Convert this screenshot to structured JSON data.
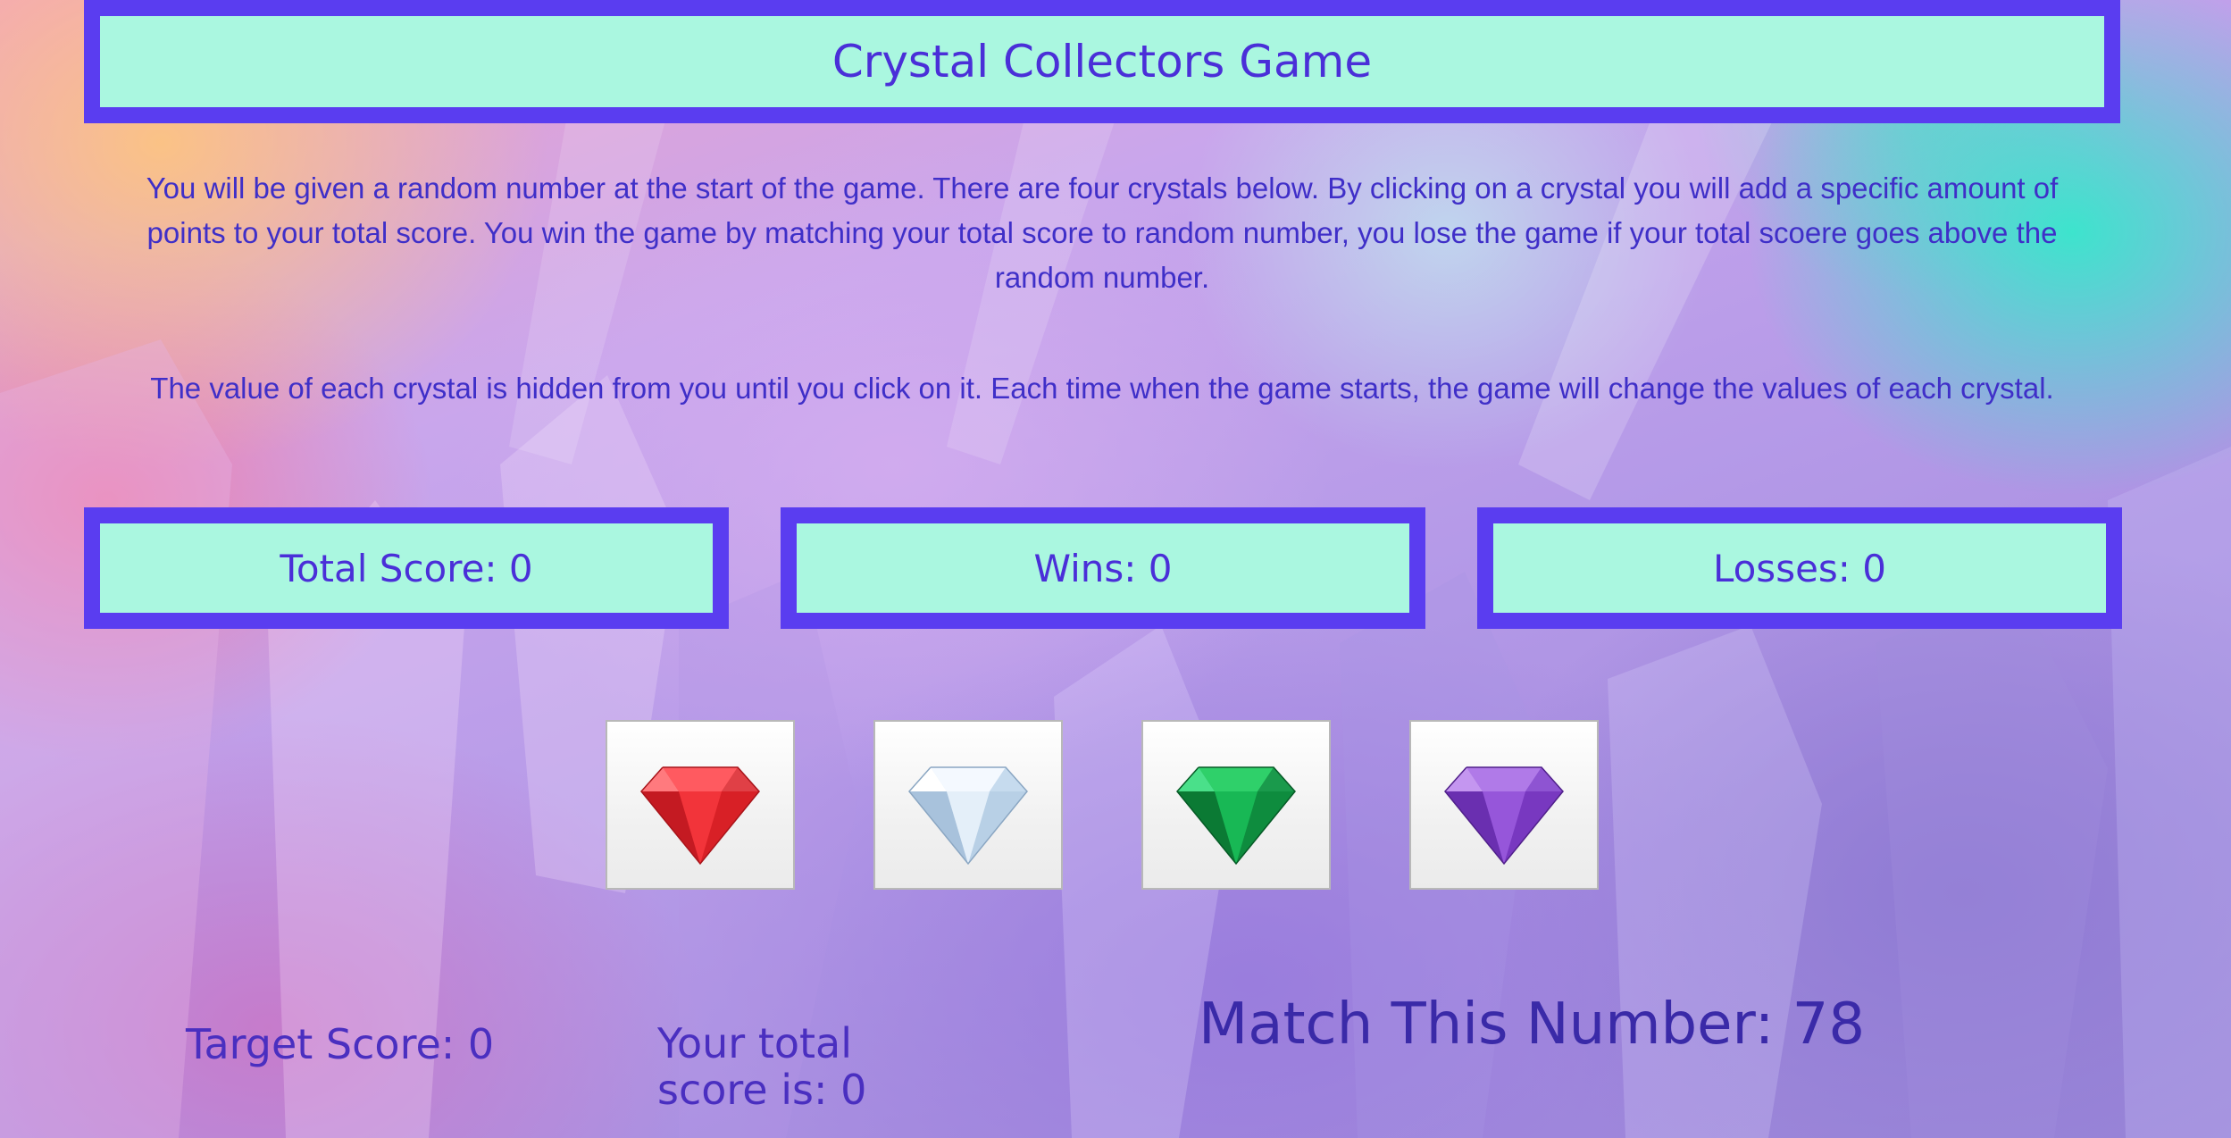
{
  "header": {
    "title": "Crystal Collectors Game"
  },
  "instructions": {
    "paragraph_1": "You will be given a random number at the start of the game. There are four crystals below. By clicking on a crystal you will add a specific amount of points to your total score. You win the game by matching your total score to random number, you lose the game if your total scoere goes above the random number.",
    "paragraph_2": "The value of each crystal is hidden from you until you click on it. Each time when the game starts, the game will change the values of each crystal."
  },
  "stats": {
    "total_score": "Total Score: 0",
    "wins": "Wins: 0",
    "losses": "Losses: 0"
  },
  "crystals": [
    {
      "name": "red-crystal",
      "color": "#e8282e"
    },
    {
      "name": "clear-crystal",
      "color": "#cfe0f0"
    },
    {
      "name": "green-crystal",
      "color": "#13a54a"
    },
    {
      "name": "purple-crystal",
      "color": "#8a4ad0"
    }
  ],
  "bottom": {
    "target_score": "Target Score: 0",
    "your_total_score": "Your total score is: 0",
    "match_number": "Match This Number: 78"
  },
  "colors": {
    "banner_background": "#aaf7e0",
    "banner_border": "#5a3df0",
    "text": "#4a2fd8"
  }
}
